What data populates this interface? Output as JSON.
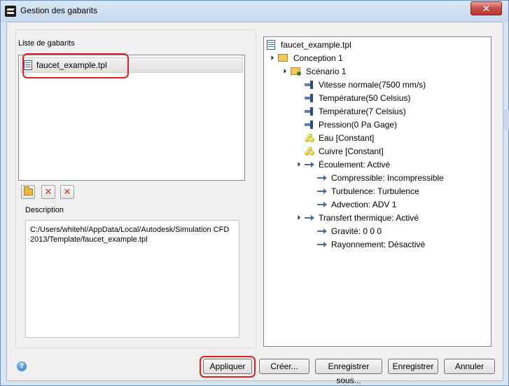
{
  "window": {
    "title": "Gestion des gabarits",
    "close_label": "✕"
  },
  "left": {
    "list_label": "Liste de gabarits",
    "items": [
      {
        "label": "faucet_example.tpl",
        "selected": true
      }
    ],
    "toolbar": {
      "open_icon": "folder-open-icon",
      "delete_icon": "delete-icon",
      "delete_all_icon": "delete-all-icon"
    },
    "description_label": "Description",
    "description_text": "C:/Users/whitehl/AppData/Local/Autodesk/Simulation CFD 2013/Template/faucet_example.tpl"
  },
  "tree": {
    "root": "faucet_example.tpl",
    "nodes": [
      {
        "label": "Conception 1",
        "icon": "folder-icon"
      },
      {
        "label": "Scénario 1",
        "icon": "scenario-icon"
      },
      {
        "label": "Vitesse normale(7500 mm/s)",
        "icon": "boundary-condition-icon"
      },
      {
        "label": "Température(50 Celsius)",
        "icon": "boundary-condition-icon"
      },
      {
        "label": "Température(7 Celsius)",
        "icon": "boundary-condition-icon"
      },
      {
        "label": "Pression(0 Pa Gage)",
        "icon": "boundary-condition-icon"
      },
      {
        "label": "Eau [Constant]",
        "icon": "material-icon"
      },
      {
        "label": "Cuivre [Constant]",
        "icon": "material-icon"
      },
      {
        "label": "Écoulement: Activé",
        "icon": "arrow-icon"
      },
      {
        "label": "Compressible: Incompressible",
        "icon": "arrow-icon"
      },
      {
        "label": "Turbulence: Turbulence",
        "icon": "arrow-icon"
      },
      {
        "label": "Advection: ADV 1",
        "icon": "arrow-icon"
      },
      {
        "label": "Transfert thermique: Activé",
        "icon": "arrow-icon"
      },
      {
        "label": "Gravité: 0 0 0",
        "icon": "arrow-icon"
      },
      {
        "label": "Rayonnement: Désactivé",
        "icon": "arrow-icon"
      }
    ]
  },
  "buttons": {
    "apply": "Appliquer",
    "create": "Créer...",
    "save_as": "Enregistrer sous...",
    "save": "Enregistrer",
    "cancel": "Annuler",
    "help": "?"
  },
  "colors": {
    "highlight": "#e02020",
    "window_frame": "#d7e4f2",
    "close_button": "#c75050"
  }
}
